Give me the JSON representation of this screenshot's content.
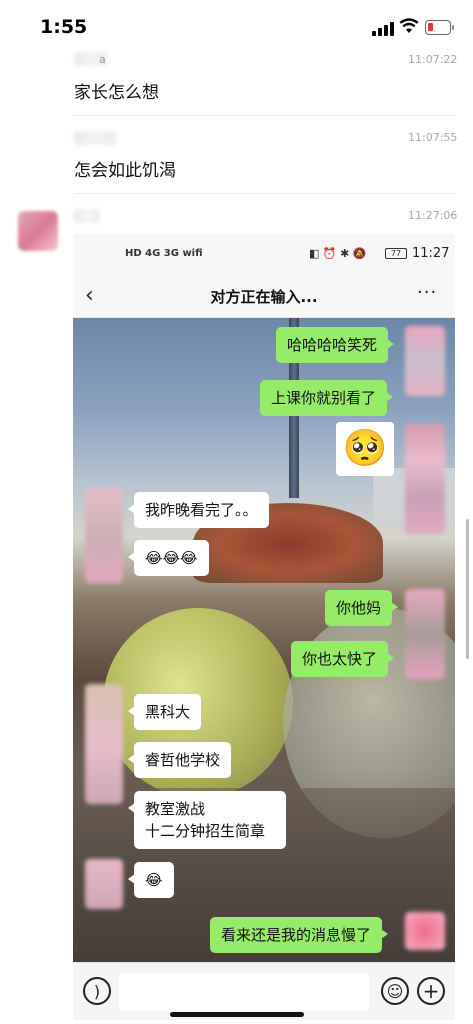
{
  "status_bar": {
    "time": "1:55"
  },
  "comments": [
    {
      "text": "家长怎么想",
      "time": "11:07:22",
      "name_visible": "a"
    },
    {
      "text": "怎会如此饥渴",
      "time": "11:07:55"
    },
    {
      "time": "11:27:06"
    }
  ],
  "screenshot": {
    "status": {
      "left_icons": "HD 4G 3G wifi",
      "battery": "77",
      "time": "11:27"
    },
    "nav": {
      "back_icon": "chevron-left-icon",
      "title": "对方正在输入...",
      "more_icon": "more-dots-icon"
    },
    "messages": [
      {
        "side": "right",
        "text": "哈哈哈哈笑死"
      },
      {
        "side": "right",
        "text": "上课你就别看了"
      },
      {
        "side": "right",
        "emoji": "🥺"
      },
      {
        "side": "left",
        "text": "我昨晚看完了。。"
      },
      {
        "side": "left",
        "text": "😂😂😂"
      },
      {
        "side": "right",
        "text": "你他妈"
      },
      {
        "side": "right",
        "text": "你也太快了"
      },
      {
        "side": "left",
        "text": "黑科大"
      },
      {
        "side": "left",
        "text": "睿哲他学校"
      },
      {
        "side": "left",
        "text": "教室激战"
      },
      {
        "side": "left",
        "text": "十二分钟招生简章"
      },
      {
        "side": "left",
        "text": "😂"
      },
      {
        "side": "right",
        "text": "看来还是我的消息慢了"
      }
    ],
    "input_bar": {
      "voice_icon": "voice-icon",
      "emoji_icon": "emoji-icon",
      "plus_icon": "plus-icon"
    }
  },
  "colors": {
    "bubble_green": "#95ec69",
    "bubble_white": "#ffffff"
  }
}
